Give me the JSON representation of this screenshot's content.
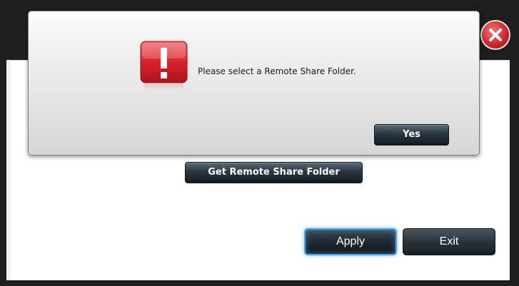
{
  "background_dialog": {
    "get_remote_button": "Get Remote Share Folder",
    "apply_button": "Apply",
    "exit_button": "Exit",
    "close_icon": "close-icon"
  },
  "alert": {
    "icon": "exclamation-warning-icon",
    "message": "Please select a Remote Share Folder.",
    "yes_button": "Yes"
  },
  "colors": {
    "close_red": "#d2262a",
    "warning_red": "#d9232a",
    "apply_focus_glow": "#4fa6e6",
    "button_dark": "#1f2a32"
  }
}
